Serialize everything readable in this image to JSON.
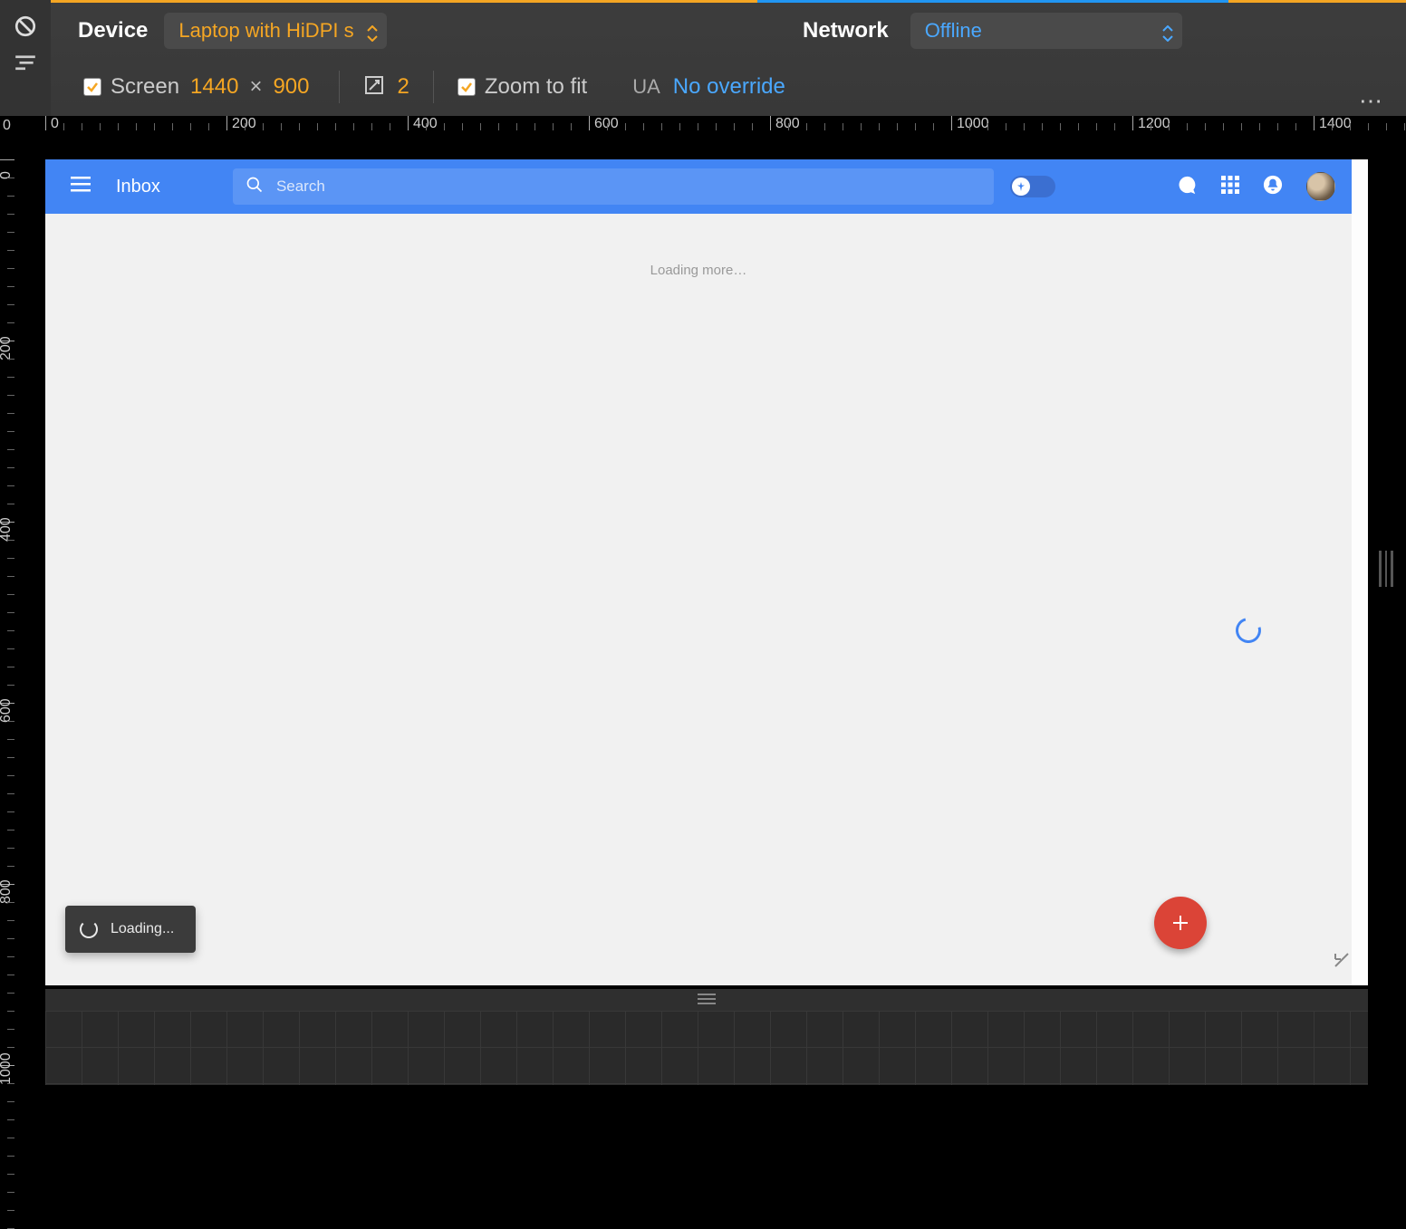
{
  "devtools": {
    "device_label": "Device",
    "device_value": "Laptop with HiDPI s",
    "network_label": "Network",
    "network_value": "Offline",
    "screen_label": "Screen",
    "screen_w": "1440",
    "screen_h": "900",
    "dpr": "2",
    "zoom_label": "Zoom to fit",
    "ua_label": "UA",
    "ua_value": "No override"
  },
  "ruler": {
    "zero": "0",
    "h_labels": [
      "0",
      "200",
      "400",
      "600",
      "800",
      "1000",
      "1200",
      "1400"
    ],
    "h_step": 200,
    "v_labels": [
      "0",
      "200",
      "400",
      "600",
      "800",
      "1000"
    ],
    "v_step": 200
  },
  "inbox": {
    "title": "Inbox",
    "search_placeholder": "Search",
    "loading_more": "Loading more…",
    "loading_toast": "Loading..."
  }
}
